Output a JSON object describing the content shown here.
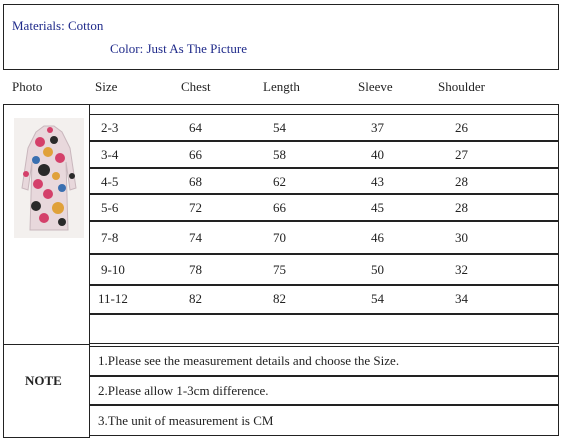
{
  "header": {
    "materials": "Materials: Cotton",
    "color": "Color: Just As The Picture"
  },
  "table": {
    "columns": [
      "Photo",
      "Size",
      "Chest",
      "Length",
      "Sleeve",
      "Shoulder"
    ],
    "rows": [
      {
        "size": "2-3",
        "chest": "64",
        "length": "54",
        "sleeve": "37",
        "shoulder": "26"
      },
      {
        "size": "3-4",
        "chest": "66",
        "length": "58",
        "sleeve": "40",
        "shoulder": "27"
      },
      {
        "size": "4-5",
        "chest": "68",
        "length": "62",
        "sleeve": "43",
        "shoulder": "28"
      },
      {
        "size": "5-6",
        "chest": "72",
        "length": "66",
        "sleeve": "45",
        "shoulder": "28"
      },
      {
        "size": "7-8",
        "chest": "74",
        "length": "70",
        "sleeve": "46",
        "shoulder": "30"
      },
      {
        "size": "9-10",
        "chest": "78",
        "length": "75",
        "sleeve": "50",
        "shoulder": "32"
      },
      {
        "size": "11-12",
        "chest": "82",
        "length": "82",
        "sleeve": "54",
        "shoulder": "34"
      }
    ]
  },
  "note": {
    "label": "NOTE",
    "items": [
      "1.Please see the measurement details and choose the Size.",
      "2.Please allow 1-3cm difference.",
      "3.The unit of measurement is CM"
    ]
  },
  "colors": {
    "header_text": "#1f2a8a",
    "border": "#222222"
  },
  "icons": {
    "photo": "floral-coat-image"
  }
}
